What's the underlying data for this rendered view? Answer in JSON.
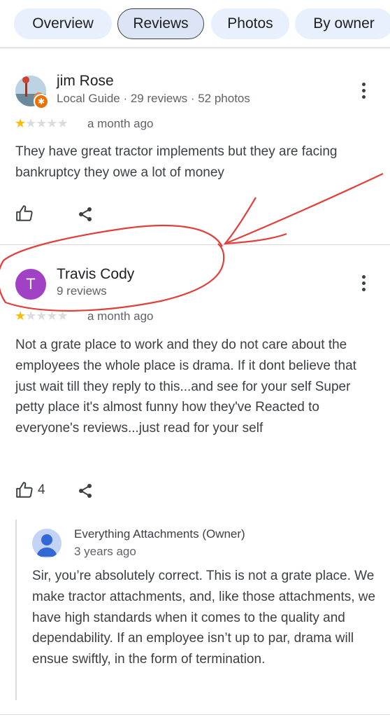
{
  "tabs": [
    {
      "label": "Overview"
    },
    {
      "label": "Reviews",
      "active": true
    },
    {
      "label": "Photos"
    },
    {
      "label": "By owner"
    }
  ],
  "reviews": [
    {
      "author": "jim Rose",
      "meta": "Local Guide · 29 reviews · 52 photos",
      "rating": 1,
      "rating_max": 5,
      "time": "a month ago",
      "text": "They have great tractor implements but they are facing bankruptcy they owe a lot of money",
      "likes": ""
    },
    {
      "author": "Travis Cody",
      "avatar_letter": "T",
      "avatar_color": "#a142c4",
      "meta": "9 reviews",
      "rating": 1,
      "rating_max": 5,
      "time": "a month ago",
      "text": "Not a grate place to work and they do not care about the employees the whole place is drama. If it dont believe that just wait till they reply to this...and see for your self Super petty place it's almost funny how they've Reacted to everyone's reviews...just read for your self",
      "likes": "4"
    }
  ],
  "owner_reply": {
    "author": "Everything Attachments (Owner)",
    "time": "3 years ago",
    "text": "Sir, you’re absolutely correct. This is not a grate place. We make tractor attachments, and, like those attachments, we have high standards when it comes to the quality and dependability. If an employee isn’t up to par, drama will ensue swiftly, in the form of termination."
  },
  "icons": {
    "like": "thumbs-up-icon",
    "share": "share-icon",
    "more": "more-vert-icon",
    "avatar": "person-icon"
  },
  "colors": {
    "tab_bg": "#e8f0fe",
    "star": "#fbbc04",
    "annotation": "#e0403a"
  }
}
